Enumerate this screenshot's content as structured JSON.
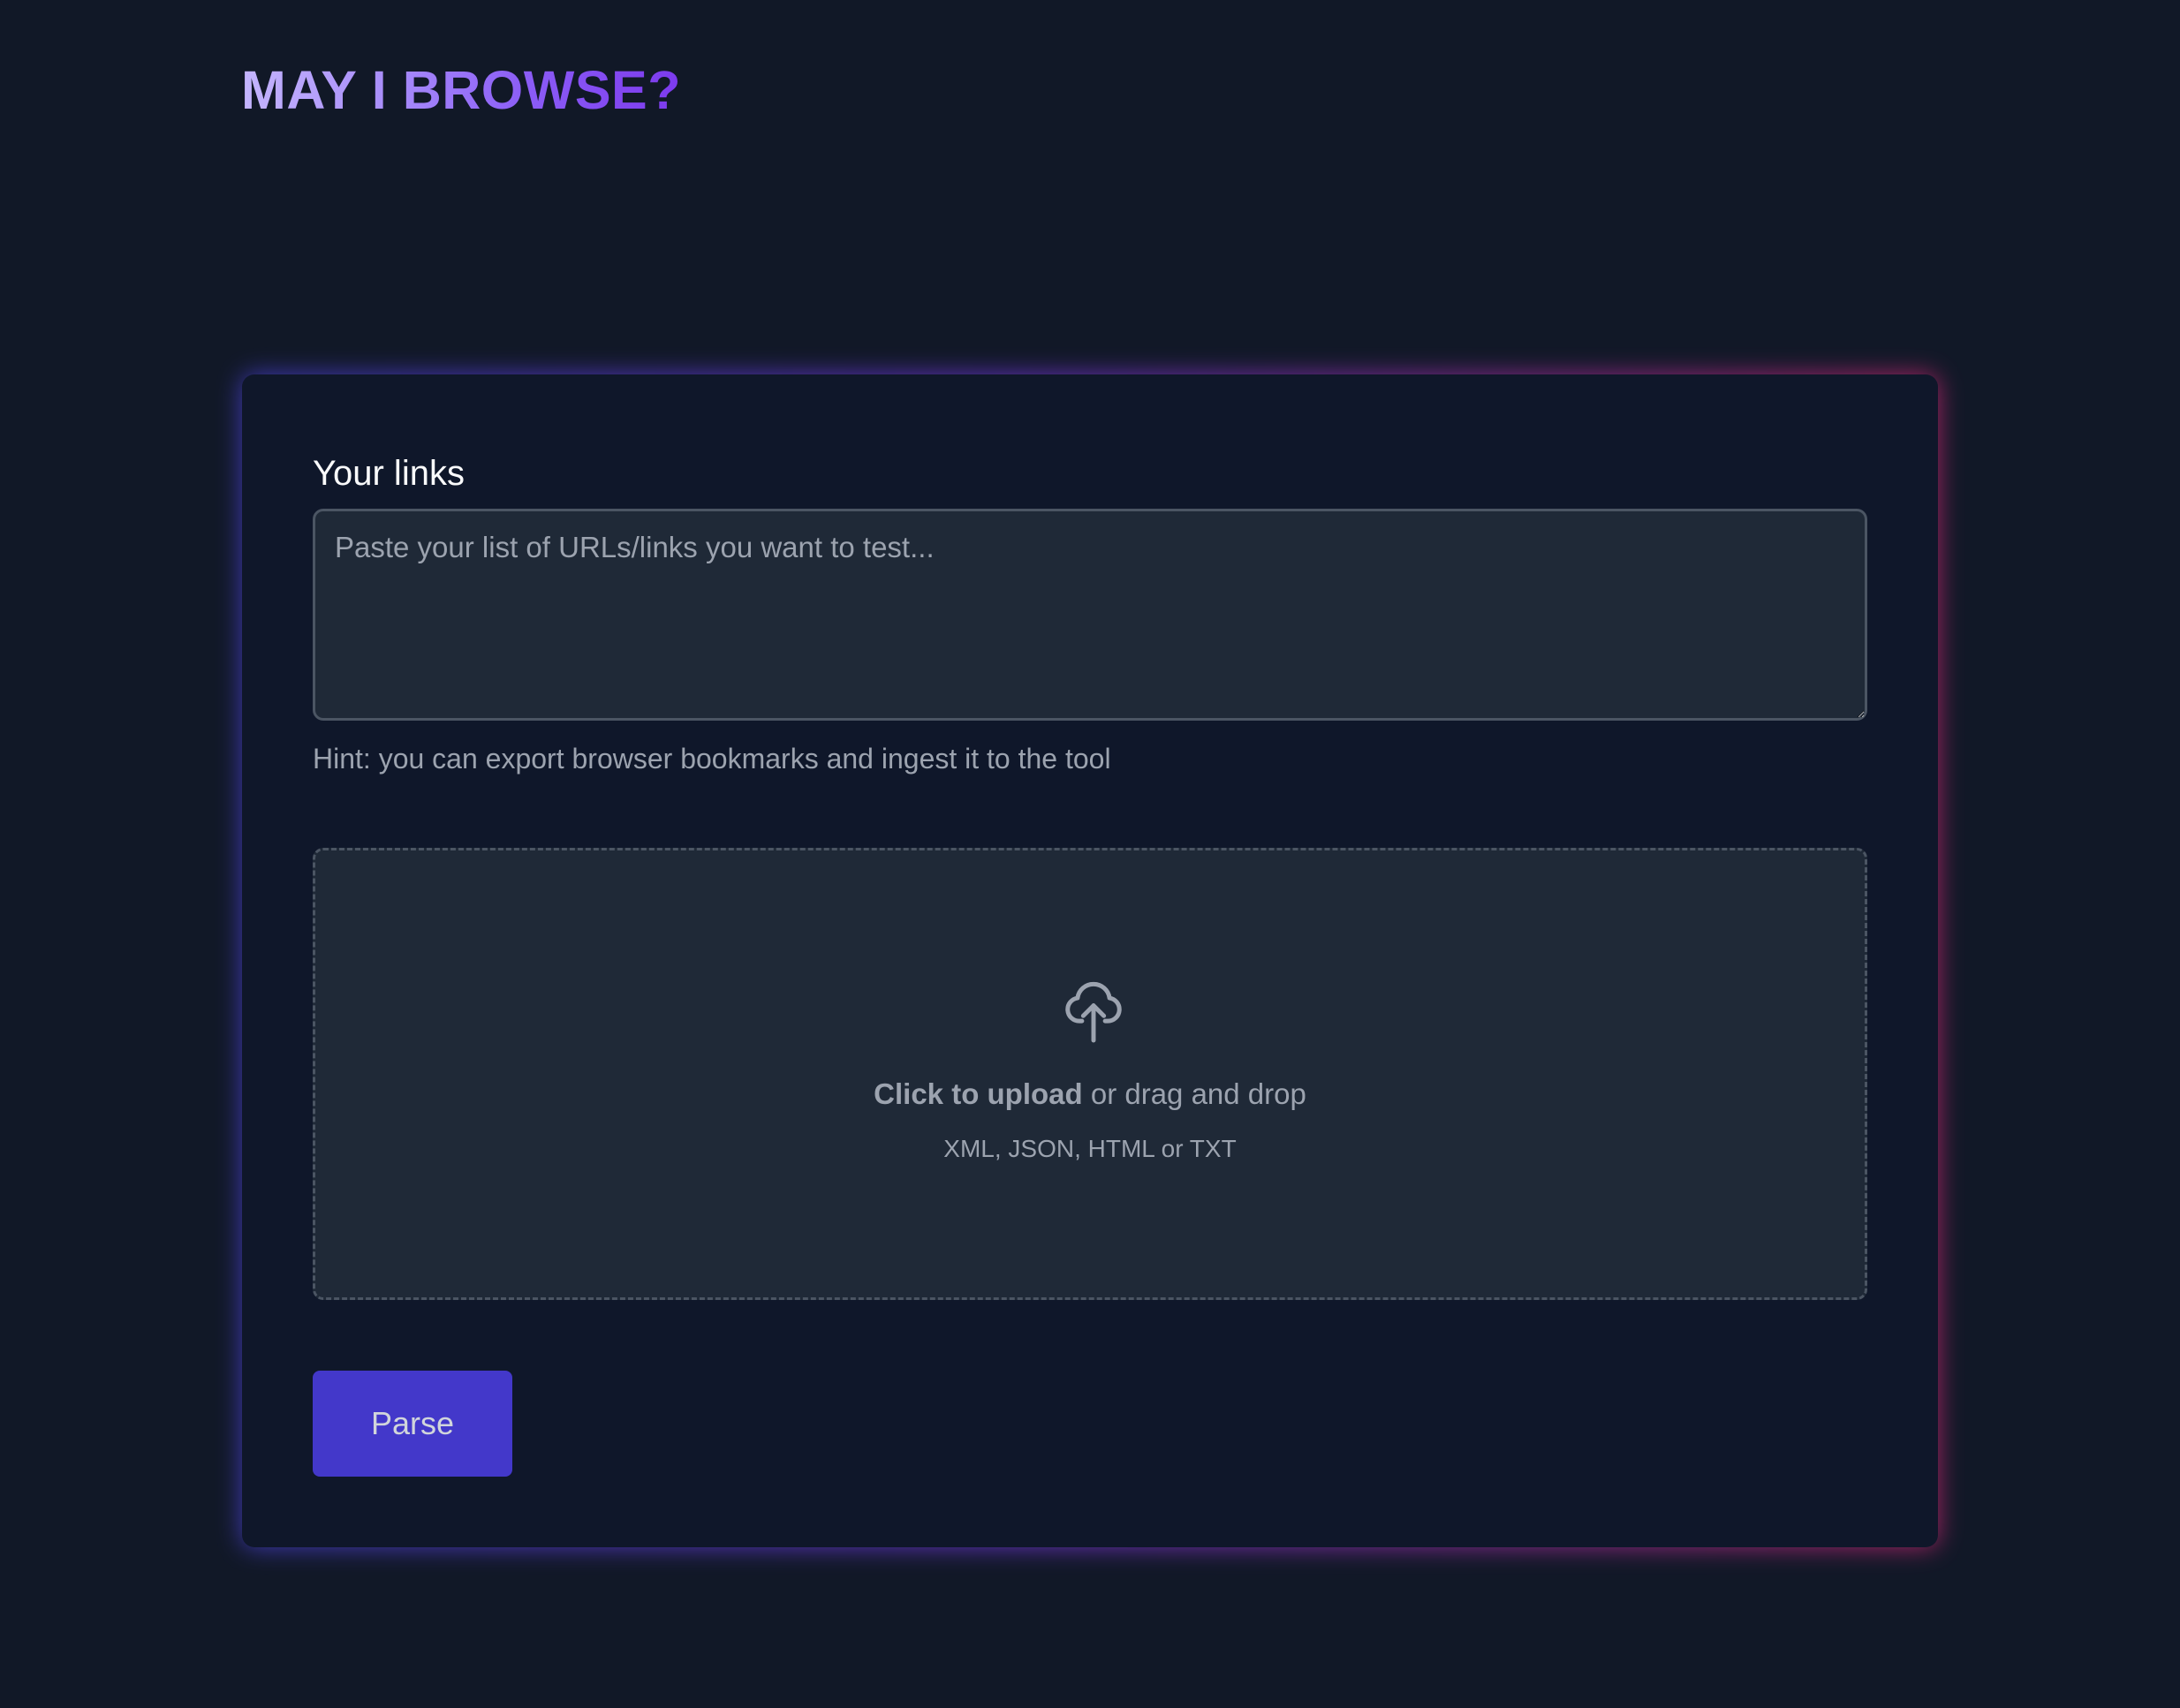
{
  "header": {
    "logo_text": "MAY I BROWSE?"
  },
  "form": {
    "links_label": "Your links",
    "links_placeholder": "Paste your list of URLs/links you want to test...",
    "links_value": "",
    "hint": "Hint: you can export browser bookmarks and ingest it to the tool"
  },
  "upload": {
    "icon": "cloud-upload-icon",
    "click_label": "Click to upload",
    "drag_label": " or drag and drop",
    "formats": "XML, JSON, HTML or TXT"
  },
  "actions": {
    "parse_label": "Parse"
  },
  "colors": {
    "background": "#111827",
    "card": "#0f172a",
    "input_background": "#1f2937",
    "button": "#4338ca",
    "logo_gradient_start": "#c4b5fd",
    "logo_gradient_end": "#7c3aed",
    "glow_left": "#4f46e5",
    "glow_right": "#db2777"
  }
}
